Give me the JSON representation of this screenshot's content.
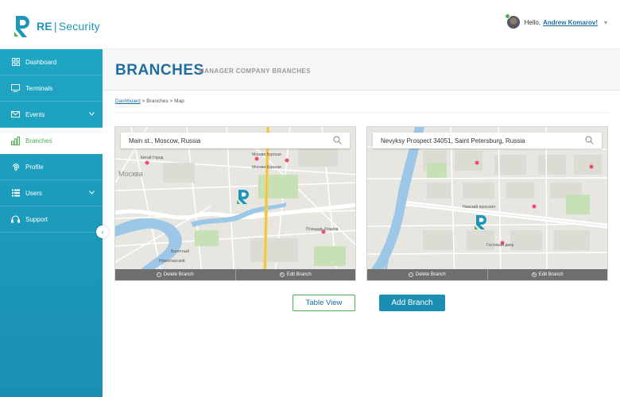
{
  "brand": {
    "name": "RE",
    "separator": "|",
    "product": "Security",
    "accent": "#1e96b8",
    "green": "#4caf50"
  },
  "user": {
    "greeting": "Hello,",
    "name": "Andrew Komarov!",
    "caret": "▾"
  },
  "sidebar": {
    "items": [
      {
        "label": "Dashboard",
        "icon": "dashboard-grid-icon",
        "active": false
      },
      {
        "label": "Terminals",
        "icon": "monitor-icon",
        "active": false
      },
      {
        "label": "Events",
        "icon": "envelope-icon",
        "active": false,
        "expandable": true
      },
      {
        "label": "Branches",
        "icon": "bar-chart-icon",
        "active": true
      },
      {
        "label": "Profile",
        "icon": "fingerprint-icon",
        "active": false
      },
      {
        "label": "Users",
        "icon": "users-list-icon",
        "active": false,
        "expandable": true
      },
      {
        "label": "Support",
        "icon": "headset-icon",
        "active": false
      }
    ],
    "collapse_glyph": "‹"
  },
  "page": {
    "title": "BRANCHES",
    "subtitle": "MANAGER COMPANY BRANCHES"
  },
  "breadcrumb": {
    "root": "Dashboard",
    "rest": " > Branches > Map"
  },
  "branches": [
    {
      "address": "Main st., Moscow, Russia",
      "delete_label": "Delete Branch",
      "edit_label": "Edit Branch",
      "map_labels": {
        "a": "Китай Город",
        "b": "Москва Курская",
        "c": "Москва Курская",
        "d": "Площадь Ильича",
        "e": "Москва",
        "f": "Болотный",
        "g": "Новоспасский"
      }
    },
    {
      "address": "Nevyksy Prospect 34051, Saint Petersburg, Russia",
      "delete_label": "Delete Branch",
      "edit_label": "Edit Branch",
      "map_labels": {
        "a": "Невский проспект",
        "b": "Гостиный двор"
      }
    }
  ],
  "buttons": {
    "table_view": "Table View",
    "add_branch": "Add Branch"
  }
}
